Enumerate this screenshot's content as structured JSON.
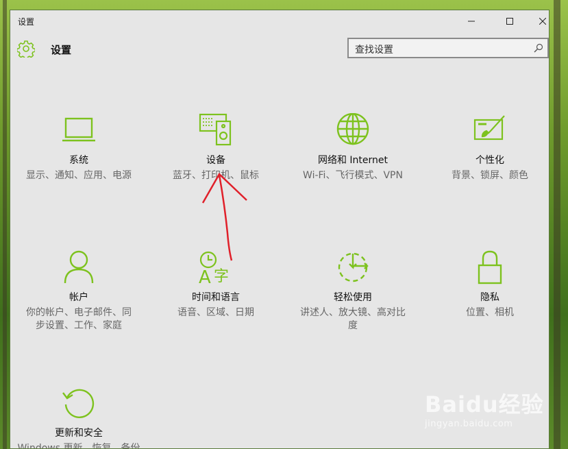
{
  "window": {
    "title": "设置"
  },
  "header": {
    "title": "设置",
    "icon": "gear-icon"
  },
  "search": {
    "placeholder": "查找设置"
  },
  "accent_color": "#7dc21e",
  "tiles": [
    {
      "icon": "laptop-icon",
      "label": "系统",
      "desc": "显示、通知、应用、电源"
    },
    {
      "icon": "devices-icon",
      "label": "设备",
      "desc": "蓝牙、打印机、鼠标"
    },
    {
      "icon": "globe-icon",
      "label": "网络和 Internet",
      "desc": "Wi-Fi、飞行模式、VPN"
    },
    {
      "icon": "personalization-icon",
      "label": "个性化",
      "desc": "背景、锁屏、颜色"
    },
    {
      "icon": "person-icon",
      "label": "帐户",
      "desc": "你的帐户、电子邮件、同步设置、工作、家庭"
    },
    {
      "icon": "time-language-icon",
      "label": "时间和语言",
      "desc": "语音、区域、日期"
    },
    {
      "icon": "ease-of-access-icon",
      "label": "轻松使用",
      "desc": "讲述人、放大镜、高对比度"
    },
    {
      "icon": "lock-icon",
      "label": "隐私",
      "desc": "位置、相机"
    },
    {
      "icon": "update-icon",
      "label": "更新和安全",
      "desc": "Windows 更新、恢复、备份"
    }
  ],
  "watermark": {
    "logo": "Baidu经验",
    "url": "jingyan.baidu.com"
  }
}
